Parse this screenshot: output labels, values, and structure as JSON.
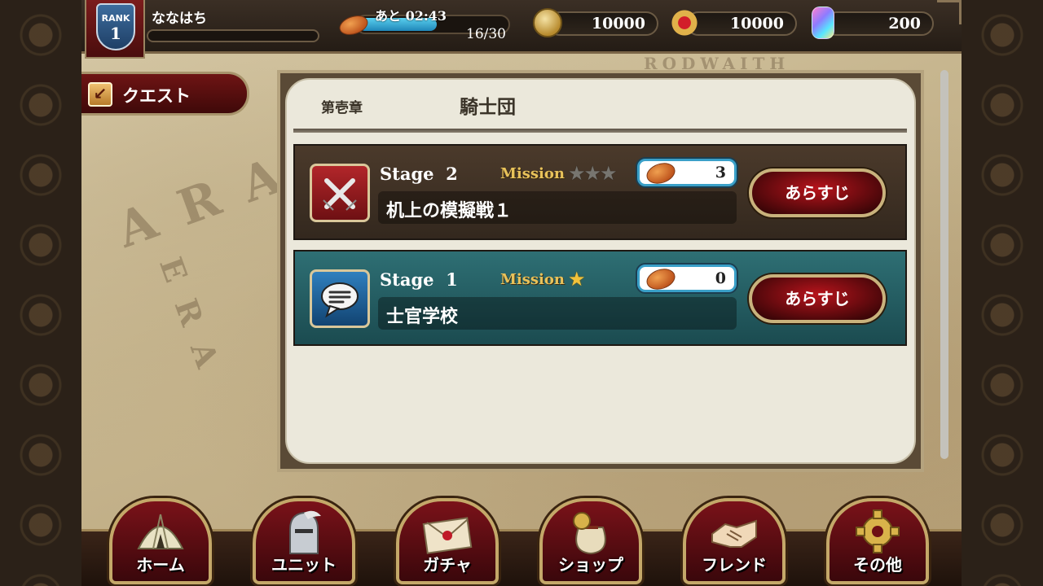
{
  "header": {
    "rank_label": "RANK",
    "rank_value": "1",
    "player_name": "ななはち",
    "stamina": {
      "timer": "あと 02:43",
      "count": "16/30",
      "fill_fraction": 0.53
    },
    "currencies": [
      {
        "icon": "gold-coin-icon",
        "value": "10000"
      },
      {
        "icon": "medal-icon",
        "value": "10000"
      },
      {
        "icon": "crystal-icon",
        "value": "200"
      }
    ]
  },
  "quest_tab": {
    "back_icon": "back-arrow-icon",
    "label": "クエスト"
  },
  "chapter": {
    "label": "第壱章",
    "name": "騎士団"
  },
  "stages": [
    {
      "stage_label": "Stage",
      "stage_number": "2",
      "mission_label": "Mission",
      "stars": "★★★",
      "stars_earned": 0,
      "cost": "3",
      "name": "机上の模擬戦１",
      "icon": "crossed-swords-icon",
      "synopsis_label": "あらすじ",
      "theme": "brown"
    },
    {
      "stage_label": "Stage",
      "stage_number": "1",
      "mission_label": "Mission",
      "stars": "★",
      "stars_earned": 1,
      "cost": "0",
      "name": "士官学校",
      "icon": "speech-bubble-icon",
      "synopsis_label": "あらすじ",
      "theme": "teal"
    }
  ],
  "nav": [
    {
      "label": "ホーム",
      "icon": "tent-icon"
    },
    {
      "label": "ユニット",
      "icon": "knight-helmet-icon"
    },
    {
      "label": "ガチャ",
      "icon": "sealed-letter-icon"
    },
    {
      "label": "ショップ",
      "icon": "coin-bag-icon"
    },
    {
      "label": "フレンド",
      "icon": "handshake-icon"
    },
    {
      "label": "その他",
      "icon": "gear-icon"
    }
  ],
  "colors": {
    "accent_gold": "#c9b27c",
    "button_red": "#b8141c",
    "stamina_blue": "#1f86b8",
    "star_gold": "#f2c23a"
  }
}
